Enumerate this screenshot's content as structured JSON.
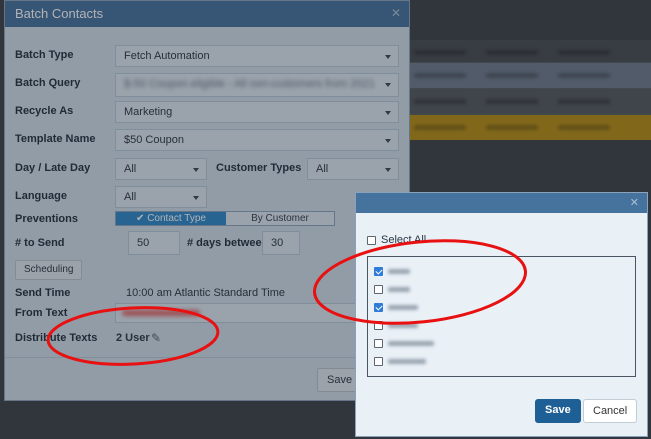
{
  "modal": {
    "title": "Batch Contacts",
    "fields": {
      "batch_type": {
        "label": "Batch Type",
        "value": "Fetch Automation"
      },
      "batch_query": {
        "label": "Batch Query",
        "value": "$-50 Coupon eligible - All non-customers from 2021"
      },
      "recycle_as": {
        "label": "Recycle As",
        "value": "Marketing"
      },
      "template_name": {
        "label": "Template Name",
        "value": "$50 Coupon"
      },
      "day_late_day": {
        "label": "Day / Late Day",
        "value": "All"
      },
      "customer_types": {
        "label": "Customer Types",
        "value": "All"
      },
      "language": {
        "label": "Language",
        "value": "All"
      },
      "preventions": {
        "label": "Preventions",
        "options": [
          "Contact Type",
          "By Customer"
        ],
        "selected": "Contact Type"
      },
      "num_to_send": {
        "label": "# to Send",
        "value": "50"
      },
      "days_between": {
        "label": "# days between",
        "value": "30"
      },
      "scheduling": {
        "label": "Scheduling"
      },
      "send_time": {
        "label": "Send Time",
        "value": "10:00 am Atlantic Standard Time"
      },
      "from_text": {
        "label": "From Text"
      },
      "distribute_texts": {
        "label": "Distribute Texts",
        "value": "2 User"
      }
    },
    "save_label": "Save"
  },
  "dialog": {
    "select_all_label": "Select All",
    "users": [
      {
        "checked": true
      },
      {
        "checked": false
      },
      {
        "checked": true
      },
      {
        "checked": false
      },
      {
        "checked": false
      },
      {
        "checked": false
      }
    ],
    "save_label": "Save",
    "cancel_label": "Cancel"
  },
  "colors": {
    "header": "#46729e",
    "primary_button": "#1e5f96",
    "toggle_active": "#2f87c8",
    "annotation": "#e81010",
    "highlight_row": "#b68d12"
  },
  "icons": {
    "edit": "pencil-icon",
    "close": "close-icon",
    "dropdown": "caret-down-icon"
  }
}
